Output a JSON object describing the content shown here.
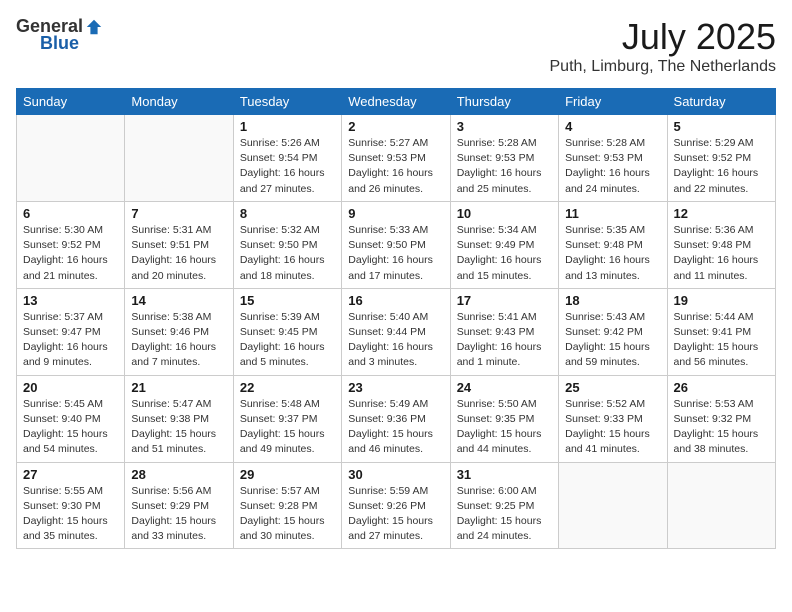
{
  "header": {
    "logo": {
      "text_general": "General",
      "text_blue": "Blue"
    },
    "title": "July 2025",
    "location": "Puth, Limburg, The Netherlands"
  },
  "weekdays": [
    "Sunday",
    "Monday",
    "Tuesday",
    "Wednesday",
    "Thursday",
    "Friday",
    "Saturday"
  ],
  "weeks": [
    [
      {
        "day": null,
        "info": ""
      },
      {
        "day": null,
        "info": ""
      },
      {
        "day": "1",
        "info": "Sunrise: 5:26 AM\nSunset: 9:54 PM\nDaylight: 16 hours\nand 27 minutes."
      },
      {
        "day": "2",
        "info": "Sunrise: 5:27 AM\nSunset: 9:53 PM\nDaylight: 16 hours\nand 26 minutes."
      },
      {
        "day": "3",
        "info": "Sunrise: 5:28 AM\nSunset: 9:53 PM\nDaylight: 16 hours\nand 25 minutes."
      },
      {
        "day": "4",
        "info": "Sunrise: 5:28 AM\nSunset: 9:53 PM\nDaylight: 16 hours\nand 24 minutes."
      },
      {
        "day": "5",
        "info": "Sunrise: 5:29 AM\nSunset: 9:52 PM\nDaylight: 16 hours\nand 22 minutes."
      }
    ],
    [
      {
        "day": "6",
        "info": "Sunrise: 5:30 AM\nSunset: 9:52 PM\nDaylight: 16 hours\nand 21 minutes."
      },
      {
        "day": "7",
        "info": "Sunrise: 5:31 AM\nSunset: 9:51 PM\nDaylight: 16 hours\nand 20 minutes."
      },
      {
        "day": "8",
        "info": "Sunrise: 5:32 AM\nSunset: 9:50 PM\nDaylight: 16 hours\nand 18 minutes."
      },
      {
        "day": "9",
        "info": "Sunrise: 5:33 AM\nSunset: 9:50 PM\nDaylight: 16 hours\nand 17 minutes."
      },
      {
        "day": "10",
        "info": "Sunrise: 5:34 AM\nSunset: 9:49 PM\nDaylight: 16 hours\nand 15 minutes."
      },
      {
        "day": "11",
        "info": "Sunrise: 5:35 AM\nSunset: 9:48 PM\nDaylight: 16 hours\nand 13 minutes."
      },
      {
        "day": "12",
        "info": "Sunrise: 5:36 AM\nSunset: 9:48 PM\nDaylight: 16 hours\nand 11 minutes."
      }
    ],
    [
      {
        "day": "13",
        "info": "Sunrise: 5:37 AM\nSunset: 9:47 PM\nDaylight: 16 hours\nand 9 minutes."
      },
      {
        "day": "14",
        "info": "Sunrise: 5:38 AM\nSunset: 9:46 PM\nDaylight: 16 hours\nand 7 minutes."
      },
      {
        "day": "15",
        "info": "Sunrise: 5:39 AM\nSunset: 9:45 PM\nDaylight: 16 hours\nand 5 minutes."
      },
      {
        "day": "16",
        "info": "Sunrise: 5:40 AM\nSunset: 9:44 PM\nDaylight: 16 hours\nand 3 minutes."
      },
      {
        "day": "17",
        "info": "Sunrise: 5:41 AM\nSunset: 9:43 PM\nDaylight: 16 hours\nand 1 minute."
      },
      {
        "day": "18",
        "info": "Sunrise: 5:43 AM\nSunset: 9:42 PM\nDaylight: 15 hours\nand 59 minutes."
      },
      {
        "day": "19",
        "info": "Sunrise: 5:44 AM\nSunset: 9:41 PM\nDaylight: 15 hours\nand 56 minutes."
      }
    ],
    [
      {
        "day": "20",
        "info": "Sunrise: 5:45 AM\nSunset: 9:40 PM\nDaylight: 15 hours\nand 54 minutes."
      },
      {
        "day": "21",
        "info": "Sunrise: 5:47 AM\nSunset: 9:38 PM\nDaylight: 15 hours\nand 51 minutes."
      },
      {
        "day": "22",
        "info": "Sunrise: 5:48 AM\nSunset: 9:37 PM\nDaylight: 15 hours\nand 49 minutes."
      },
      {
        "day": "23",
        "info": "Sunrise: 5:49 AM\nSunset: 9:36 PM\nDaylight: 15 hours\nand 46 minutes."
      },
      {
        "day": "24",
        "info": "Sunrise: 5:50 AM\nSunset: 9:35 PM\nDaylight: 15 hours\nand 44 minutes."
      },
      {
        "day": "25",
        "info": "Sunrise: 5:52 AM\nSunset: 9:33 PM\nDaylight: 15 hours\nand 41 minutes."
      },
      {
        "day": "26",
        "info": "Sunrise: 5:53 AM\nSunset: 9:32 PM\nDaylight: 15 hours\nand 38 minutes."
      }
    ],
    [
      {
        "day": "27",
        "info": "Sunrise: 5:55 AM\nSunset: 9:30 PM\nDaylight: 15 hours\nand 35 minutes."
      },
      {
        "day": "28",
        "info": "Sunrise: 5:56 AM\nSunset: 9:29 PM\nDaylight: 15 hours\nand 33 minutes."
      },
      {
        "day": "29",
        "info": "Sunrise: 5:57 AM\nSunset: 9:28 PM\nDaylight: 15 hours\nand 30 minutes."
      },
      {
        "day": "30",
        "info": "Sunrise: 5:59 AM\nSunset: 9:26 PM\nDaylight: 15 hours\nand 27 minutes."
      },
      {
        "day": "31",
        "info": "Sunrise: 6:00 AM\nSunset: 9:25 PM\nDaylight: 15 hours\nand 24 minutes."
      },
      {
        "day": null,
        "info": ""
      },
      {
        "day": null,
        "info": ""
      }
    ]
  ]
}
